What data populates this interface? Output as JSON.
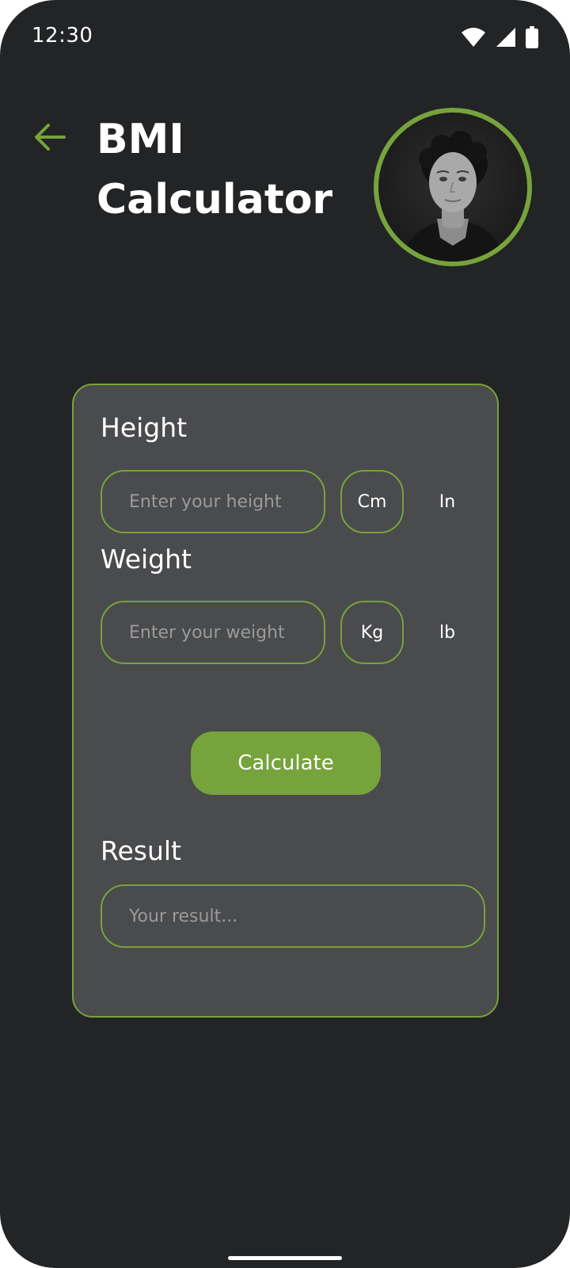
{
  "status_bar": {
    "time": "12:30",
    "icons": [
      "wifi-icon",
      "signal-icon",
      "battery-icon"
    ]
  },
  "header": {
    "back_icon": "arrow-left-icon",
    "title": "BMI Calculator"
  },
  "form": {
    "height": {
      "label": "Height",
      "placeholder": "Enter your height",
      "value": "",
      "units": [
        "Cm",
        "In"
      ],
      "selected_unit": "Cm"
    },
    "weight": {
      "label": "Weight",
      "placeholder": "Enter your weight",
      "value": "",
      "units": [
        "Kg",
        "lb"
      ],
      "selected_unit": "Kg"
    },
    "calculate_label": "Calculate",
    "result": {
      "label": "Result",
      "placeholder": "Your result..."
    }
  },
  "colors": {
    "background": "#232426",
    "card": "#4a4b4d",
    "accent": "#76a33b",
    "text": "#ffffff",
    "placeholder": "#9a9a9a"
  }
}
